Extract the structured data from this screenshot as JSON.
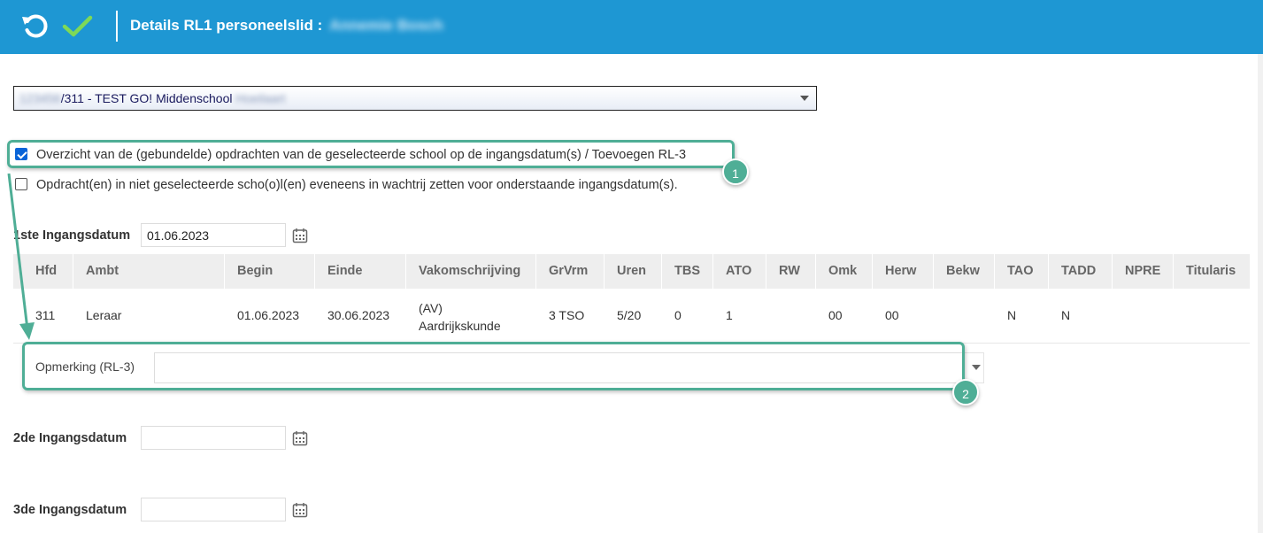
{
  "header": {
    "title": "Details RL1 personeelslid :",
    "name_redacted": "Annemie Bosch"
  },
  "school_select": {
    "code_redacted": "123456",
    "value": "/311 - TEST GO! Middenschool",
    "suffix_redacted": "Hoeilaart"
  },
  "options": {
    "overview_label": "Overzicht van de (gebundelde) opdrachten van de geselecteerde school op de ingangsdatum(s) / Toevoegen RL-3",
    "overview_checked": true,
    "queue_label": "Opdracht(en) in niet geselecteerde scho(o)l(en) eveneens in wachtrij zetten voor onderstaande ingangsdatum(s).",
    "queue_checked": false
  },
  "dates": {
    "first_label": "1ste Ingangsdatum",
    "first_value": "01.06.2023",
    "second_label": "2de Ingangsdatum",
    "second_value": "",
    "third_label": "3de Ingangsdatum",
    "third_value": ""
  },
  "grid": {
    "columns": [
      "Hfd",
      "Ambt",
      "Begin",
      "Einde",
      "Vakomschrijving",
      "GrVrm",
      "Uren",
      "TBS",
      "ATO",
      "RW",
      "Omk",
      "Herw",
      "Bekw",
      "TAO",
      "TADD",
      "NPRE",
      "Titularis"
    ],
    "rows": [
      {
        "hfd": "311",
        "ambt": "Leraar",
        "begin": "01.06.2023",
        "einde": "30.06.2023",
        "vak_line1": "(AV)",
        "vak_line2": "Aardrijkskunde",
        "grvrm": "3 TSO",
        "uren": "5/20",
        "tbs": "0",
        "ato": "1",
        "rw": "",
        "omk": "00",
        "herw": "00",
        "bekw": "",
        "tao": "N",
        "tadd": "N",
        "npre": "",
        "titularis": ""
      }
    ]
  },
  "remark": {
    "label": "Opmerking (RL-3)",
    "value": ""
  },
  "callouts": {
    "one": "1",
    "two": "2"
  },
  "colors": {
    "header_bg": "#1e97d3",
    "callout": "#4fae96",
    "check_green": "#7ed957",
    "checkbox_blue": "#0a64d8"
  }
}
